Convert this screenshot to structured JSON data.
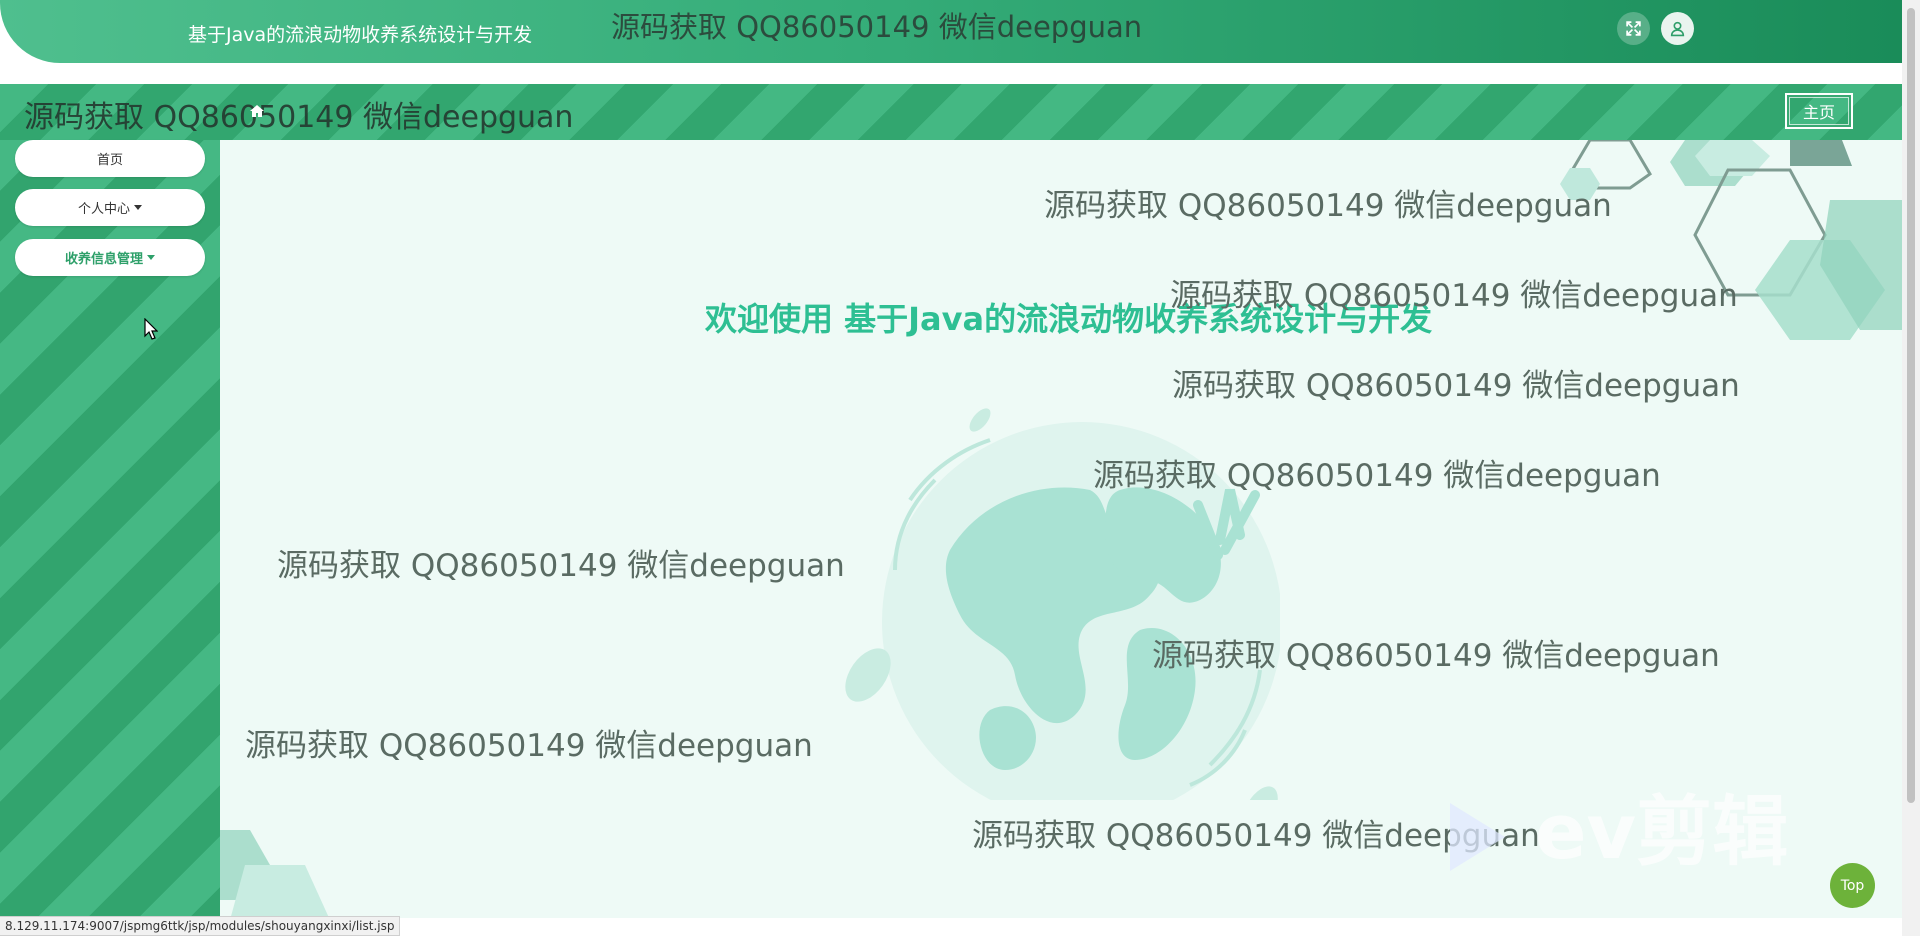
{
  "header": {
    "app_title": "基于Java的流浪动物收养系统设计与开发",
    "watermark": "源码获取 QQ86050149 微信deepguan",
    "fullscreen_icon": "expand-icon",
    "user_icon": "user-icon"
  },
  "band": {
    "watermark": "源码获取 QQ86050149 微信deepguan",
    "home_label": "主页"
  },
  "sidebar": {
    "items": [
      {
        "label": "首页",
        "has_dropdown": false,
        "active": false
      },
      {
        "label": "个人中心",
        "has_dropdown": true,
        "active": false
      },
      {
        "label": "收养信息管理",
        "has_dropdown": true,
        "active": true
      }
    ]
  },
  "content": {
    "welcome": "欢迎使用 基于Java的流浪动物收养系统设计与开发",
    "watermarks": [
      "源码获取 QQ86050149 微信deepguan",
      "源码获取 QQ86050149 微信deepguan",
      "源码获取 QQ86050149 微信deepguan",
      "源码获取 QQ86050149 微信deepguan",
      "源码获取 QQ86050149 微信deepguan",
      "源码获取 QQ86050149 微信deepguan",
      "源码获取 QQ86050149 微信deepguan",
      "源码获取 QQ86050149 微信deepguan"
    ],
    "video_watermark": "ev剪辑"
  },
  "top_button": "Top",
  "status_url": "8.129.11.174:9007/jspmg6ttk/jsp/modules/shouyangxinxi/list.jsp",
  "colors": {
    "primary": "#35ad79",
    "welcome": "#2ebf93",
    "top_button": "#6db23a"
  }
}
